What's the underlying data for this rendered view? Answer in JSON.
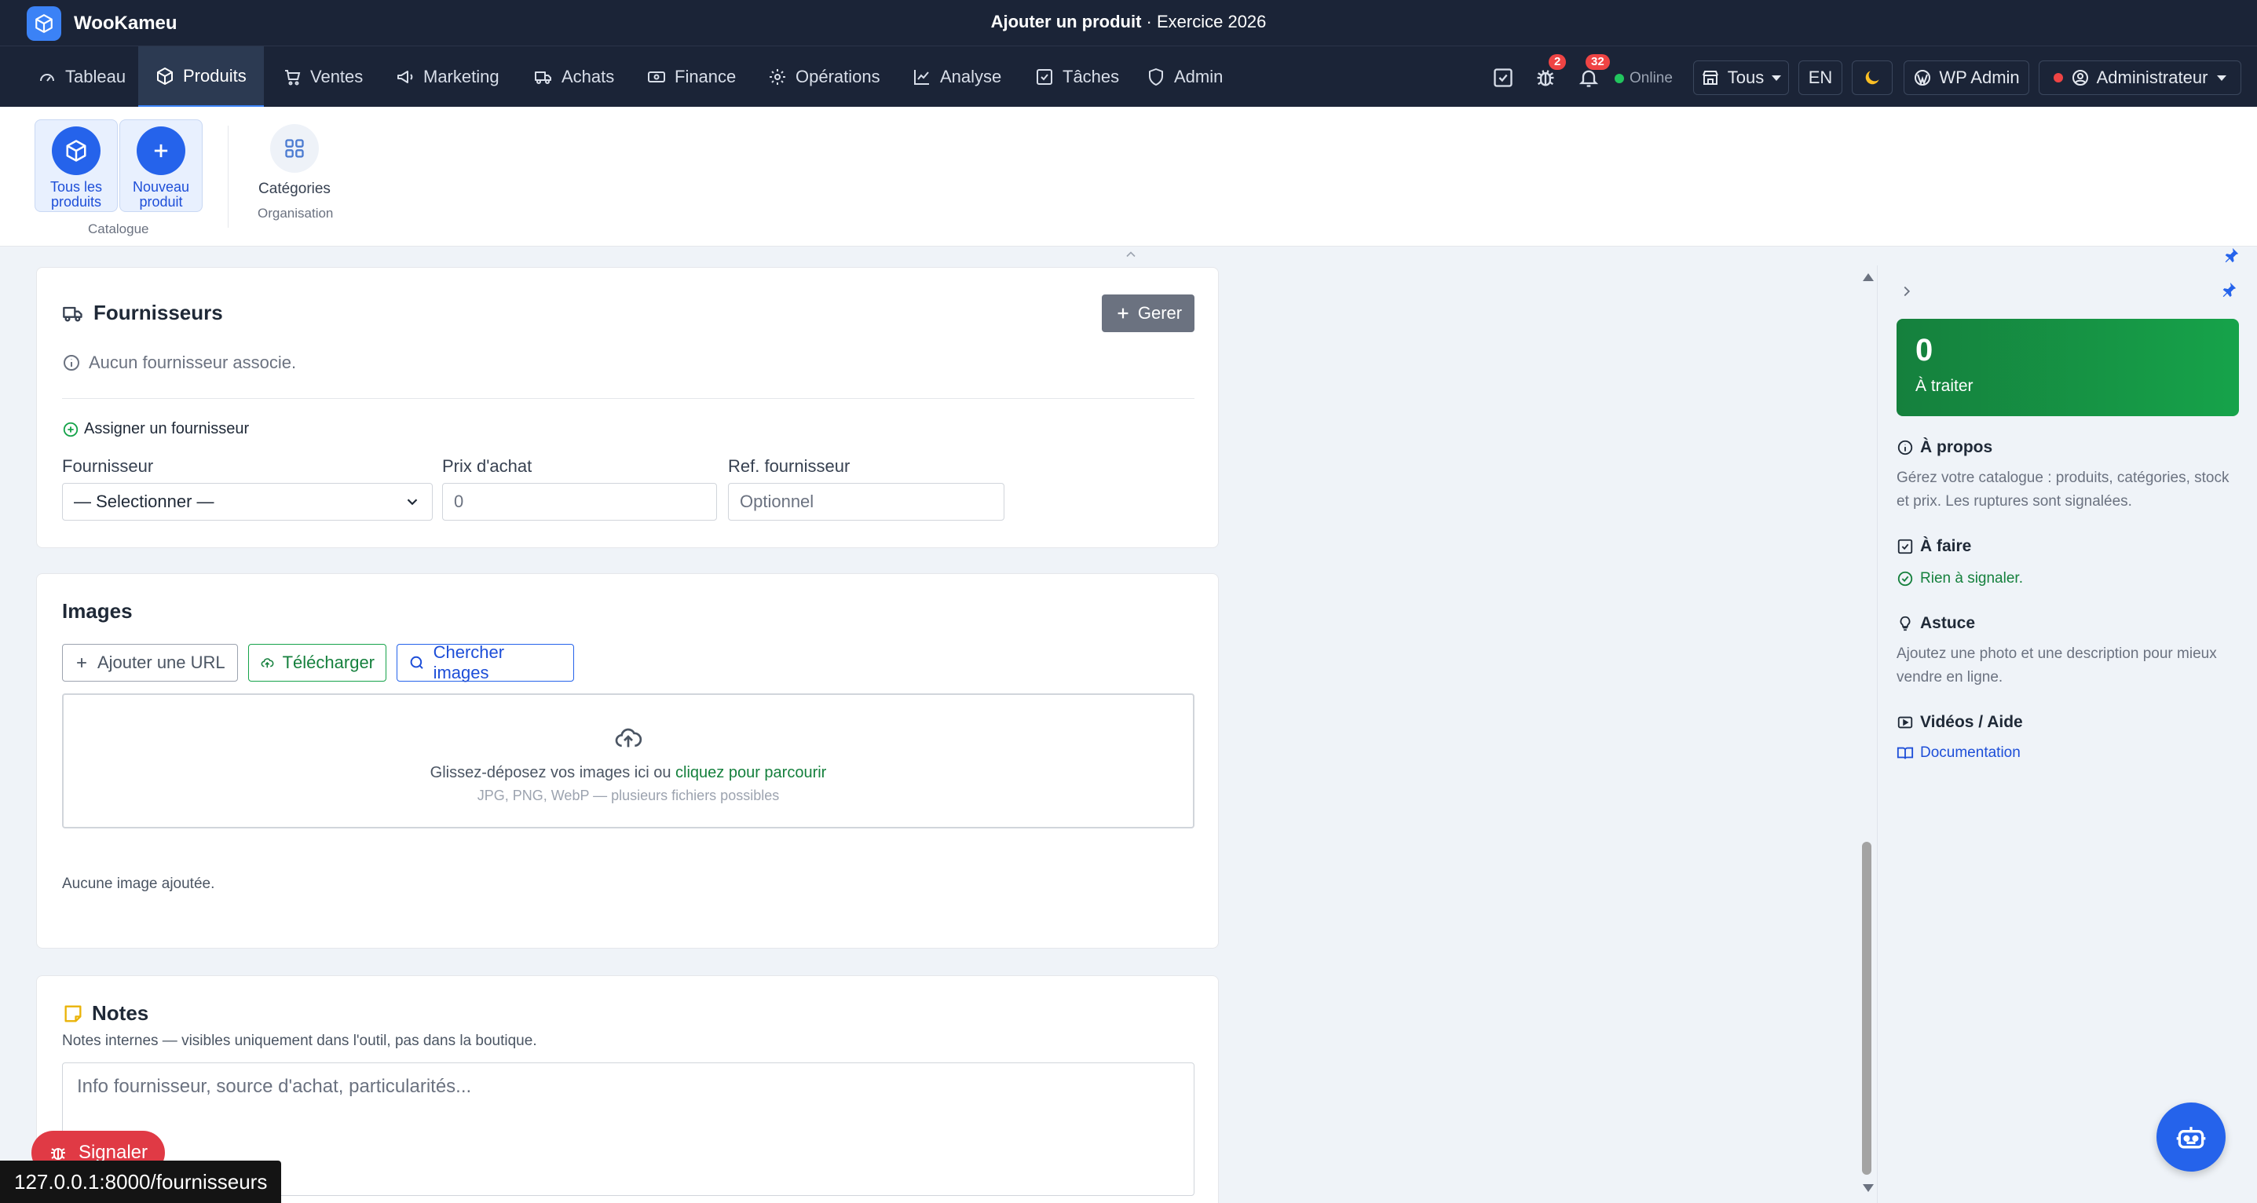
{
  "app": {
    "name": "WooKameu",
    "page_title_bold": "Ajouter un produit",
    "page_title_rest": " · Exercice 2026"
  },
  "nav": {
    "items": [
      {
        "label": "Tableau",
        "icon": "gauge-icon"
      },
      {
        "label": "Produits",
        "icon": "box-icon"
      },
      {
        "label": "Ventes",
        "icon": "cart-icon"
      },
      {
        "label": "Marketing",
        "icon": "megaphone-icon"
      },
      {
        "label": "Achats",
        "icon": "truck-icon"
      },
      {
        "label": "Finance",
        "icon": "banknote-icon"
      },
      {
        "label": "Opérations",
        "icon": "gear-icon"
      },
      {
        "label": "Analyse",
        "icon": "chart-line-icon"
      },
      {
        "label": "Tâches",
        "icon": "check-square-icon"
      },
      {
        "label": "Admin",
        "icon": "shield-icon"
      }
    ],
    "bug_count": "2",
    "notif_count": "32",
    "status": "Online",
    "store_select": "Tous",
    "lang": "EN",
    "wp_admin": "WP Admin",
    "user": "Administrateur"
  },
  "ribbon": {
    "all_products": "Tous les produits",
    "new_product": "Nouveau produit",
    "catalogue_group": "Catalogue",
    "categories": "Catégories",
    "organisation_group": "Organisation"
  },
  "suppliers": {
    "title": "Fournisseurs",
    "manage_btn": "Gerer",
    "empty": "Aucun fournisseur associe.",
    "assign_link": "Assigner un fournisseur",
    "supplier_label": "Fournisseur",
    "supplier_value": "— Selectionner —",
    "price_label": "Prix d'achat",
    "price_value": "0",
    "ref_label": "Ref. fournisseur",
    "ref_placeholder": "Optionnel"
  },
  "images": {
    "title": "Images",
    "add_url": "Ajouter une URL",
    "upload": "Télécharger",
    "search": "Chercher images",
    "drop_text": "Glissez-déposez vos images ici ou ",
    "drop_link": "cliquez pour parcourir",
    "drop_hint": "JPG, PNG, WebP — plusieurs fichiers possibles",
    "empty": "Aucune image ajoutée."
  },
  "notes": {
    "title": "Notes",
    "subtitle": "Notes internes — visibles uniquement dans l'outil, pas dans la boutique.",
    "placeholder": "Info fournisseur, source d'achat, particularités..."
  },
  "panel": {
    "count": "0",
    "count_label": "À traiter",
    "about_title": "À propos",
    "about_text": "Gérez votre catalogue : produits, catégories, stock et prix. Les ruptures sont signalées.",
    "todo_title": "À faire",
    "todo_text": "Rien à signaler.",
    "tip_title": "Astuce",
    "tip_text": "Ajoutez une photo et une description pour mieux vendre en ligne.",
    "videos_title": "Vidéos / Aide",
    "doc_link": "Documentation"
  },
  "report_btn": "Signaler",
  "status_url": "127.0.0.1:8000/fournisseurs",
  "colors": {
    "topbar": "#1b2437",
    "accent": "#2563eb",
    "green": "#15803d",
    "danger": "#e03a45"
  }
}
